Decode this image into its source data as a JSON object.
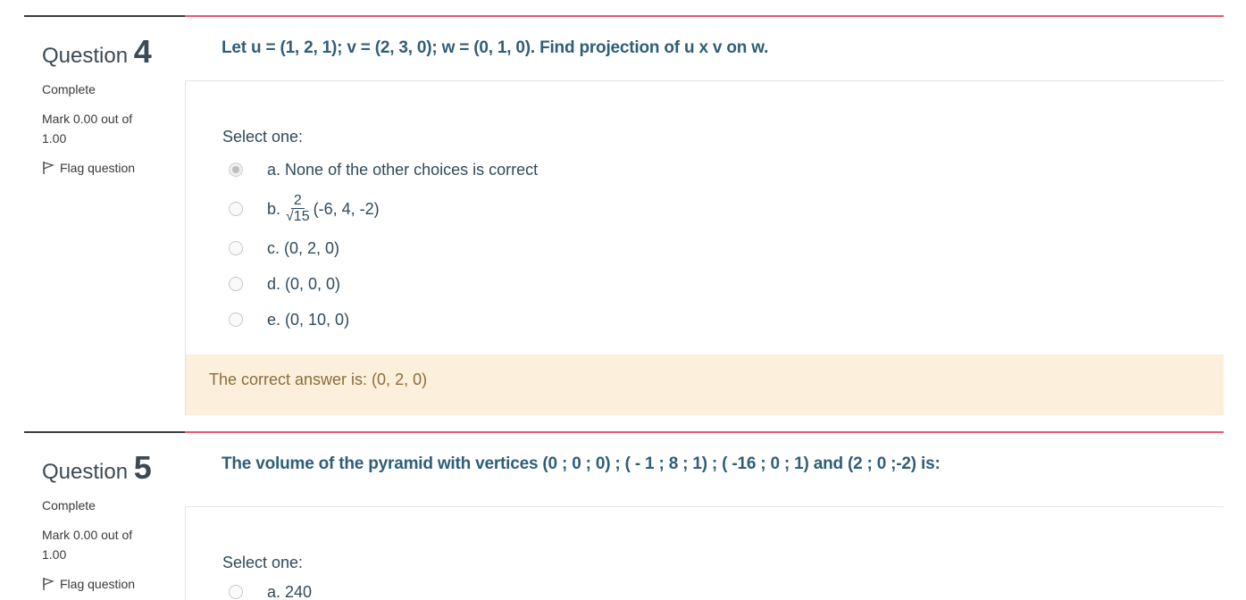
{
  "questions": [
    {
      "title_word": "Question",
      "number": "4",
      "state": "Complete",
      "grade": "Mark 0.00 out of 1.00",
      "flag_label": "Flag question",
      "text": "Let u = (1, 2, 1); v = (2, 3, 0); w = (0, 1, 0). Find projection of u x v on w.",
      "prompt": "Select one:",
      "options": [
        {
          "letter": "a.",
          "label": "None of the other choices is correct",
          "checked": true
        },
        {
          "letter": "b.",
          "frac_num": "2",
          "frac_den": "√15",
          "label": "(-6, 4, -2)",
          "checked": false
        },
        {
          "letter": "c.",
          "label": "(0, 2, 0)",
          "checked": false
        },
        {
          "letter": "d.",
          "label": "(0, 0, 0)",
          "checked": false
        },
        {
          "letter": "e.",
          "label": "(0, 10, 0)",
          "checked": false
        }
      ],
      "feedback": "The correct answer is: (0, 2, 0)"
    },
    {
      "title_word": "Question",
      "number": "5",
      "state": "Complete",
      "grade": "Mark 0.00 out of 1.00",
      "flag_label": "Flag question",
      "text": "The volume of the pyramid with vertices (0 ; 0 ; 0) ; ( - 1 ; 8 ; 1) ; ( -16 ; 0 ; 1) and (2 ; 0 ;-2) is:",
      "prompt": "Select one:",
      "options": [
        {
          "letter": "a.",
          "label": "240",
          "checked": false
        }
      ]
    }
  ]
}
